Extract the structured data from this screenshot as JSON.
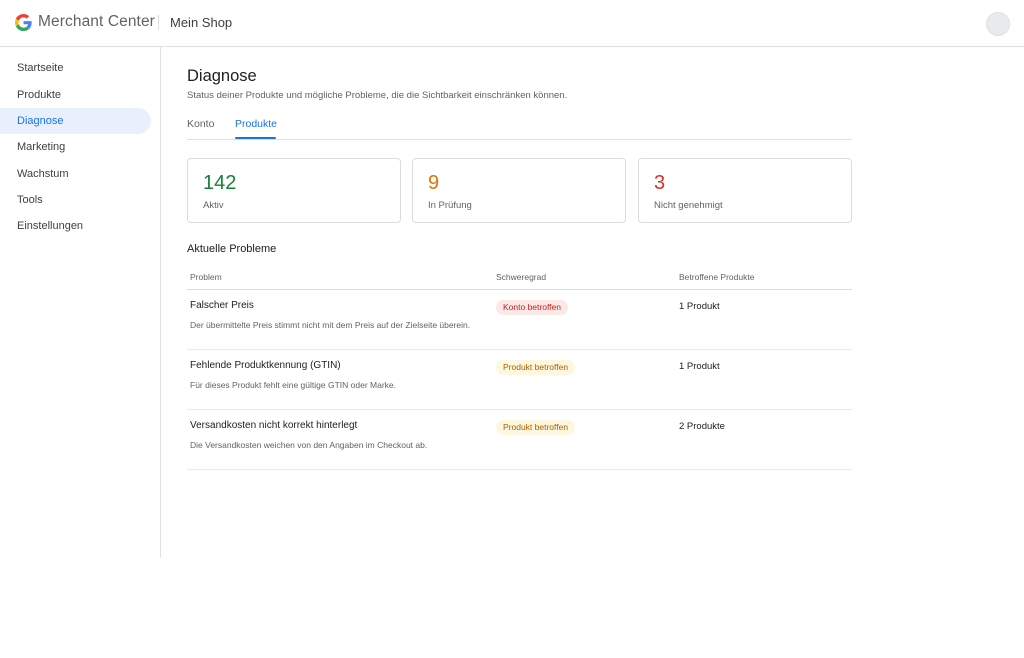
{
  "header": {
    "brand": "Merchant Center",
    "shop": "Mein Shop"
  },
  "sidebar": {
    "items": [
      {
        "label": "Startseite"
      },
      {
        "label": "Produkte"
      },
      {
        "label": "Diagnose",
        "active": true
      },
      {
        "label": "Marketing"
      },
      {
        "label": "Wachstum"
      },
      {
        "label": "Tools"
      },
      {
        "label": "Einstellungen"
      }
    ]
  },
  "page": {
    "title": "Diagnose",
    "subtitle": "Status deiner Produkte und mögliche Probleme, die die Sichtbarkeit einschränken können."
  },
  "tabs": [
    {
      "label": "Konto",
      "active": false
    },
    {
      "label": "Produkte",
      "active": true
    }
  ],
  "stats": [
    {
      "value": "142",
      "label": "Aktiv",
      "color": "#188038"
    },
    {
      "value": "9",
      "label": "In Prüfung",
      "color": "#e37400"
    },
    {
      "value": "3",
      "label": "Nicht genehmigt",
      "color": "#d93025"
    }
  ],
  "issues": {
    "section_title": "Aktuelle Probleme",
    "columns": [
      "Problem",
      "Schweregrad",
      "Betroffene Produkte"
    ],
    "rows": [
      {
        "title": "Falscher Preis",
        "description": "Der übermittelte Preis stimmt nicht mit dem Preis auf der Zielseite überein.",
        "severity": "Konto betroffen",
        "severity_color": "#c5221f",
        "affected": "1 Produkt"
      },
      {
        "title": "Fehlende Produktkennung (GTIN)",
        "description": "Für dieses Produkt fehlt eine gültige GTIN oder Marke.",
        "severity": "Produkt betroffen",
        "severity_color": "#b06000",
        "affected": "1 Produkt"
      },
      {
        "title": "Versandkosten nicht korrekt hinterlegt",
        "description": "Die Versandkosten weichen von den Angaben im Checkout ab.",
        "severity": "Produkt betroffen",
        "severity_color": "#b06000",
        "affected": "2 Produkte"
      }
    ]
  }
}
